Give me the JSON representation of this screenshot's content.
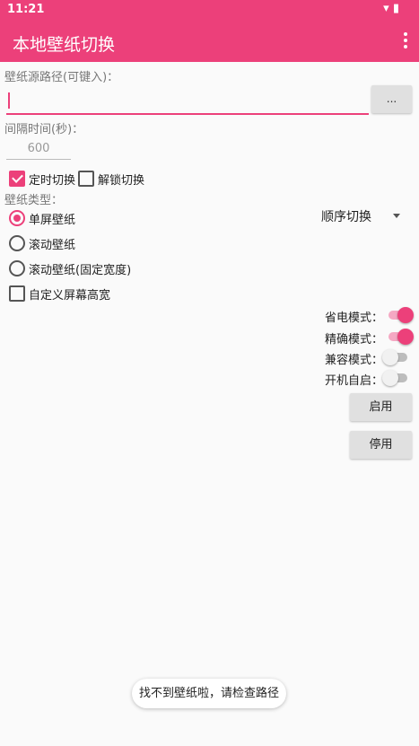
{
  "status_bar": {
    "time": "11:21"
  },
  "app_bar": {
    "title": "本地壁纸切换"
  },
  "source": {
    "label": "壁纸源路径(可键入)：",
    "value": "",
    "browse_label": "..."
  },
  "interval": {
    "label": "间隔时间(秒)：",
    "value": "600"
  },
  "checks": {
    "timed": {
      "label": "定时切换",
      "checked": true
    },
    "unlock": {
      "label": "解锁切换",
      "checked": false
    }
  },
  "wallpaper_type": {
    "label": "壁纸类型：",
    "options": [
      {
        "label": "单屏壁纸",
        "selected": true
      },
      {
        "label": "滚动壁纸",
        "selected": false
      },
      {
        "label": "滚动壁纸(固定宽度)",
        "selected": false
      }
    ],
    "order": "顺序切换"
  },
  "custom_screen": {
    "label": "自定义屏幕高宽",
    "checked": false
  },
  "modes": [
    {
      "label": "省电模式：",
      "on": true
    },
    {
      "label": "精确模式：",
      "on": true
    },
    {
      "label": "兼容模式：",
      "on": false
    },
    {
      "label": "开机自启：",
      "on": false
    }
  ],
  "buttons": {
    "enable": "启用",
    "disable": "停用"
  },
  "toast": "找不到壁纸啦，请检查路径",
  "colors": {
    "accent": "#ec407a",
    "accent_light": "#f5a8c3",
    "button": "#e0e0e0"
  }
}
